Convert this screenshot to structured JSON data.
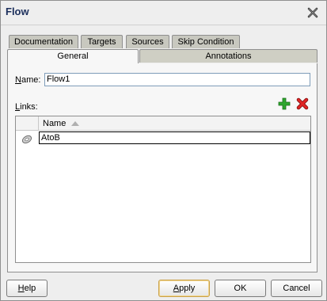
{
  "dialog": {
    "title": "Flow"
  },
  "tabs_row1": [
    {
      "label": "Documentation"
    },
    {
      "label": "Targets"
    },
    {
      "label": "Sources"
    },
    {
      "label": "Skip Condition"
    }
  ],
  "tabs_row2": [
    {
      "label": "General",
      "active": true
    },
    {
      "label": "Annotations",
      "active": false
    }
  ],
  "form": {
    "name_label_first": "N",
    "name_label_rest": "ame:",
    "name_value": "Flow1",
    "links_label_first": "L",
    "links_label_rest": "inks:"
  },
  "table": {
    "header_name": "Name",
    "rows": [
      {
        "name": "AtoB"
      }
    ]
  },
  "buttons": {
    "help_first": "H",
    "help_rest": "elp",
    "apply_first": "A",
    "apply_rest": "pply",
    "ok": "OK",
    "cancel": "Cancel"
  },
  "colors": {
    "add_icon": "#2ea62e",
    "delete_icon": "#d42020"
  }
}
